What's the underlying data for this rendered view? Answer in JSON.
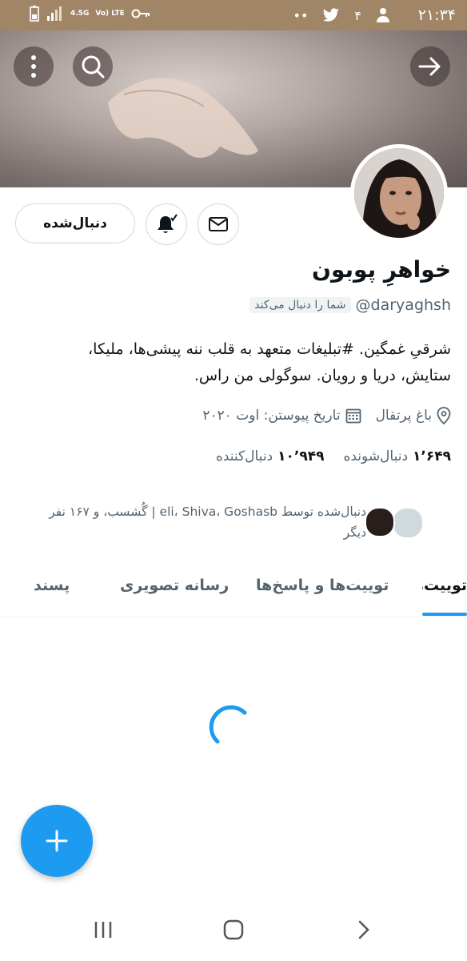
{
  "status_bar": {
    "time": "۲۱:۳۴",
    "network": "4.5G",
    "lte": "Vo) LTE"
  },
  "profile": {
    "display_name": "خواهرِ پوبون",
    "handle": "@daryaghsh",
    "follows_you": "شما را دنبال می‌کند",
    "bio_line1": "شرقیِ غمگین. #تبلیغات متعهد به قلب ننه پیشی‌ها، ملیکا،",
    "bio_line2": "ستایش، دریا و رویان. سوگولی من راس.",
    "location": "باغ پرتقال",
    "joined": "تاریخ پیوستن: اوت ۲۰۲۰",
    "following_count": "۱٬۶۴۹",
    "following_label": "دنبال‌شونده",
    "followers_count": "۱۰٬۹۴۹",
    "followers_label": "دنبال‌کننده",
    "followed_by_line1": "دنبال‌شده توسط eli، Shiva، Goshasb | گُشسب، و ۱۶۷ نفر",
    "followed_by_line2": "دیگر"
  },
  "actions": {
    "follow_state_label": "دنبال‌شده"
  },
  "tabs": [
    {
      "label": "توییت‌ها",
      "active": true
    },
    {
      "label": "توییت‌ها و پاسخ‌ها",
      "active": false
    },
    {
      "label": "رسانه تصویری",
      "active": false
    },
    {
      "label": "پسند",
      "active": false
    }
  ],
  "colors": {
    "accent": "#1d9bf0",
    "status_bar": "#a08666",
    "muted_text": "#536471"
  },
  "icons": [
    "back-arrow-icon",
    "search-icon",
    "more-icon",
    "notification-bell-icon",
    "message-icon",
    "location-icon",
    "calendar-icon",
    "compose-plus-icon",
    "loading-spinner-icon"
  ]
}
